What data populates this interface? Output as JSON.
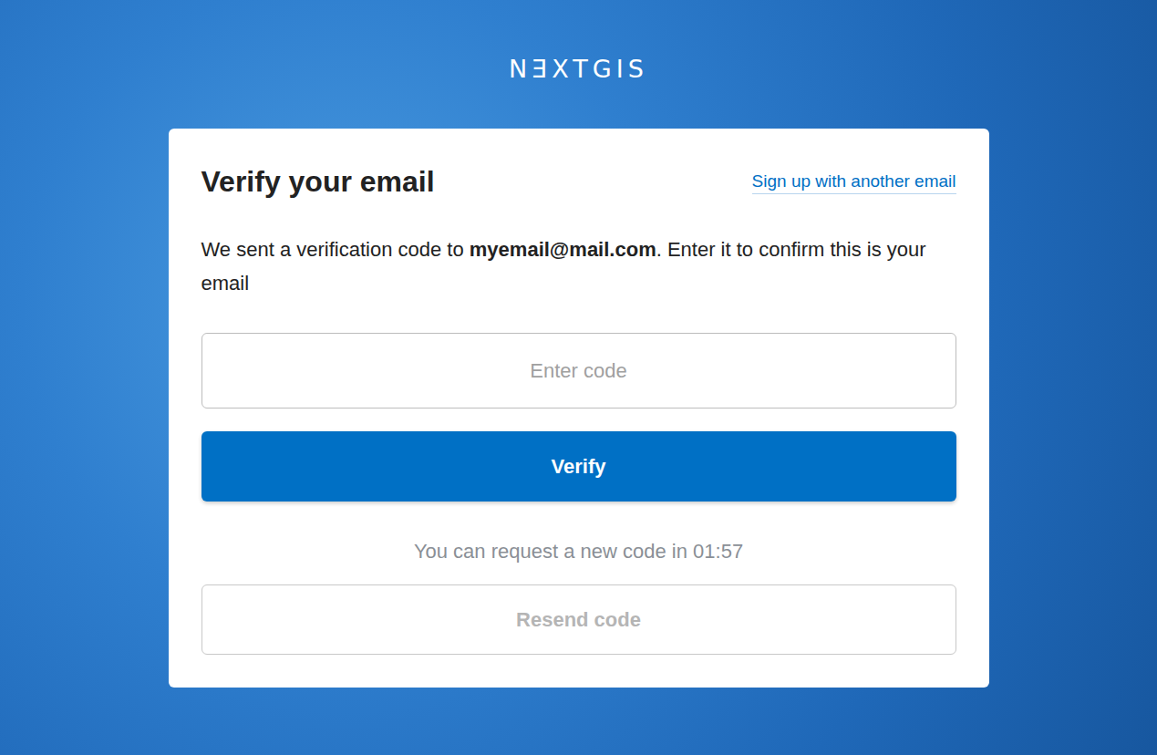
{
  "logo": "NƎXTGIS",
  "card": {
    "title": "Verify your email",
    "signup_link": "Sign up with another email",
    "message": {
      "before": "We sent a verification code to ",
      "email": "myemail@mail.com",
      "after": ". Enter it to confirm this is your email"
    },
    "code_input": {
      "placeholder": "Enter code",
      "value": ""
    },
    "verify_button": "Verify",
    "timer_text": "You can request a new code in 01:57",
    "resend_button": {
      "label": "Resend code",
      "disabled": true
    }
  }
}
